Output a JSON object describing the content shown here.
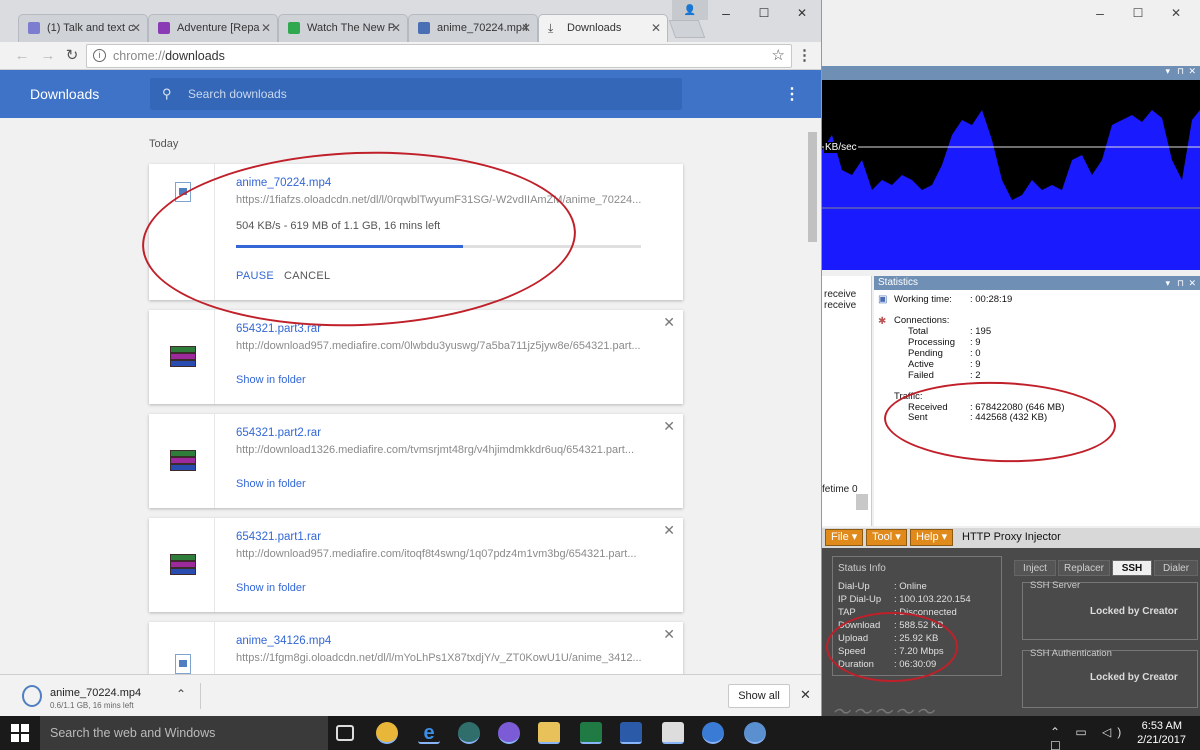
{
  "browser": {
    "tabs": [
      {
        "label": "(1) Talk and text c",
        "icon_color": "#7c7cd0"
      },
      {
        "label": "Adventure [Repa",
        "icon_color": "#8b3ab5"
      },
      {
        "label": "Watch The New P",
        "icon_color": "#2fa84f"
      },
      {
        "label": "anime_70224.mp4",
        "icon_color": "#4a6fb5"
      },
      {
        "label": "Downloads",
        "icon_color": "#444444"
      }
    ],
    "url_prefix": "chrome://",
    "url_path": "downloads",
    "window_controls": {
      "minimize": "–",
      "maximize": "☐",
      "close": "✕"
    }
  },
  "downloads_page": {
    "title": "Downloads",
    "search_placeholder": "Search downloads",
    "section_label": "Today",
    "accent_color": "#3e73c7",
    "items": [
      {
        "file_name": "anime_70224.mp4",
        "url": "https://1fiafzs.oloadcdn.net/dl/l/0rqwblTwyumF31SG/-W2vdIIAmZM/anime_70224...",
        "status": "504 KB/s - 619 MB of 1.1 GB, 16 mins left",
        "progress": 0.56,
        "actions": [
          "PAUSE",
          "CANCEL"
        ],
        "icon": "video-file-icon"
      },
      {
        "file_name": "654321.part3.rar",
        "url": "http://download957.mediafire.com/0lwbdu3yuswg/7a5ba711jz5jyw8e/654321.part...",
        "link": "Show in folder",
        "icon": "rar-archive-icon"
      },
      {
        "file_name": "654321.part2.rar",
        "url": "http://download1326.mediafire.com/tvmsrjmt48rg/v4hjimdmkkdr6uq/654321.part...",
        "link": "Show in folder",
        "icon": "rar-archive-icon"
      },
      {
        "file_name": "654321.part1.rar",
        "url": "http://download957.mediafire.com/itoqf8t4swng/1q07pdz4m1vm3bg/654321.part...",
        "link": "Show in folder",
        "icon": "rar-archive-icon"
      },
      {
        "file_name": "anime_34126.mp4",
        "url": "https://1fgm8gi.oloadcdn.net/dl/l/mYoLhPs1X87txdjY/v_ZT0KowU1U/anime_3412...",
        "icon": "video-file-icon"
      }
    ]
  },
  "download_shelf": {
    "file_name": "anime_70224.mp4",
    "progress_text": "0.6/1.1 GB, 16 mins left",
    "show_all": "Show all"
  },
  "traffic_graph": {
    "unit_label": "KB/sec",
    "fill_color": "#1a1aff"
  },
  "statistics": {
    "title": "Statistics",
    "left_labels": [
      "receive",
      "receive",
      "fetime 0"
    ],
    "working_time_label": "Working time:",
    "working_time": ": 00:28:19",
    "connections_label": "Connections:",
    "connections": [
      {
        "label": "Total",
        "value": ": 195"
      },
      {
        "label": "Processing",
        "value": ": 9"
      },
      {
        "label": "Pending",
        "value": ": 0"
      },
      {
        "label": "Active",
        "value": ": 9"
      },
      {
        "label": "Failed",
        "value": ": 2"
      }
    ],
    "traffic_label": "Traffic:",
    "traffic": [
      {
        "label": "Received",
        "value": ": 678422080   (646 MB)"
      },
      {
        "label": "Sent",
        "value": ": 442568   (432 KB)"
      }
    ]
  },
  "proxy_injector": {
    "title": "HTTP Proxy Injector",
    "menus": [
      "File ▾",
      "Tool ▾",
      "Help ▾"
    ],
    "status_title": "Status Info",
    "status": [
      {
        "label": "Dial-Up",
        "value": ": Online"
      },
      {
        "label": "IP Dial-Up",
        "value": ": 100.103.220.154"
      },
      {
        "label": "TAP",
        "value": ": Disconnected"
      },
      {
        "label": "Download",
        "value": ": 588.52 KB"
      },
      {
        "label": "Upload",
        "value": ": 25.92 KB"
      },
      {
        "label": "Speed",
        "value": ": 7.20 Mbps"
      },
      {
        "label": "Duration",
        "value": ": 06:30:09"
      }
    ],
    "tabs": [
      "Inject",
      "Replacer",
      "SSH",
      "Dialer"
    ],
    "active_tab": "SSH",
    "ssh_server_label": "SSH Server",
    "ssh_auth_label": "SSH Authentication",
    "locked_text": "Locked by Creator",
    "menu_color": "#e08a1c"
  },
  "taskbar": {
    "search_placeholder": "Search the web and Windows",
    "time": "6:53 AM",
    "date": "2/21/2017"
  }
}
